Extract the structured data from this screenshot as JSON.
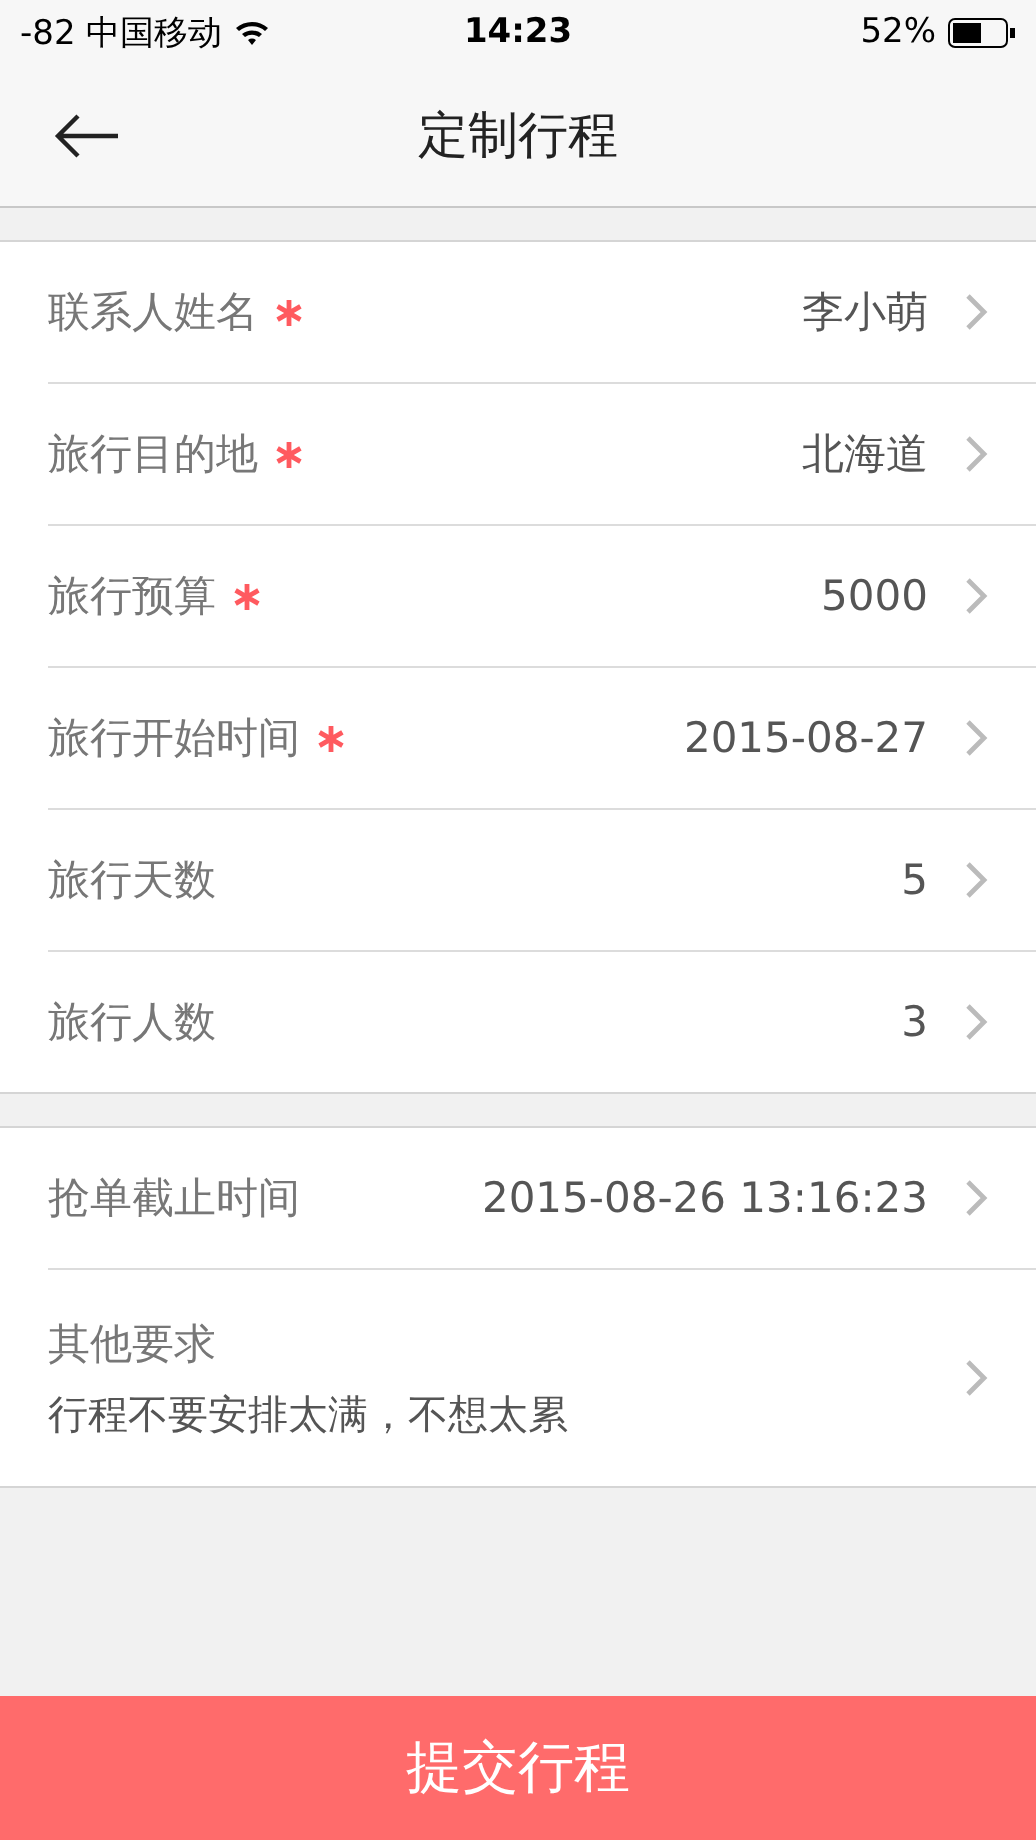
{
  "status_bar": {
    "carrier": "-82 中国移动",
    "time": "14:23",
    "battery": "52%"
  },
  "nav": {
    "title": "定制行程"
  },
  "sections": [
    {
      "rows": [
        {
          "label": "联系人姓名",
          "required": true,
          "value": "李小萌"
        },
        {
          "label": "旅行目的地",
          "required": true,
          "value": "北海道"
        },
        {
          "label": "旅行预算",
          "required": true,
          "value": "5000"
        },
        {
          "label": "旅行开始时间",
          "required": true,
          "value": "2015-08-27"
        },
        {
          "label": "旅行天数",
          "required": false,
          "value": "5"
        },
        {
          "label": "旅行人数",
          "required": false,
          "value": "3"
        }
      ]
    },
    {
      "rows": [
        {
          "label": "抢单截止时间",
          "required": false,
          "value": "2015-08-26 13:16:23"
        },
        {
          "label": "其他要求",
          "required": false,
          "note": "行程不要安排太满，不想太累"
        }
      ]
    }
  ],
  "submit_button": "提交行程"
}
